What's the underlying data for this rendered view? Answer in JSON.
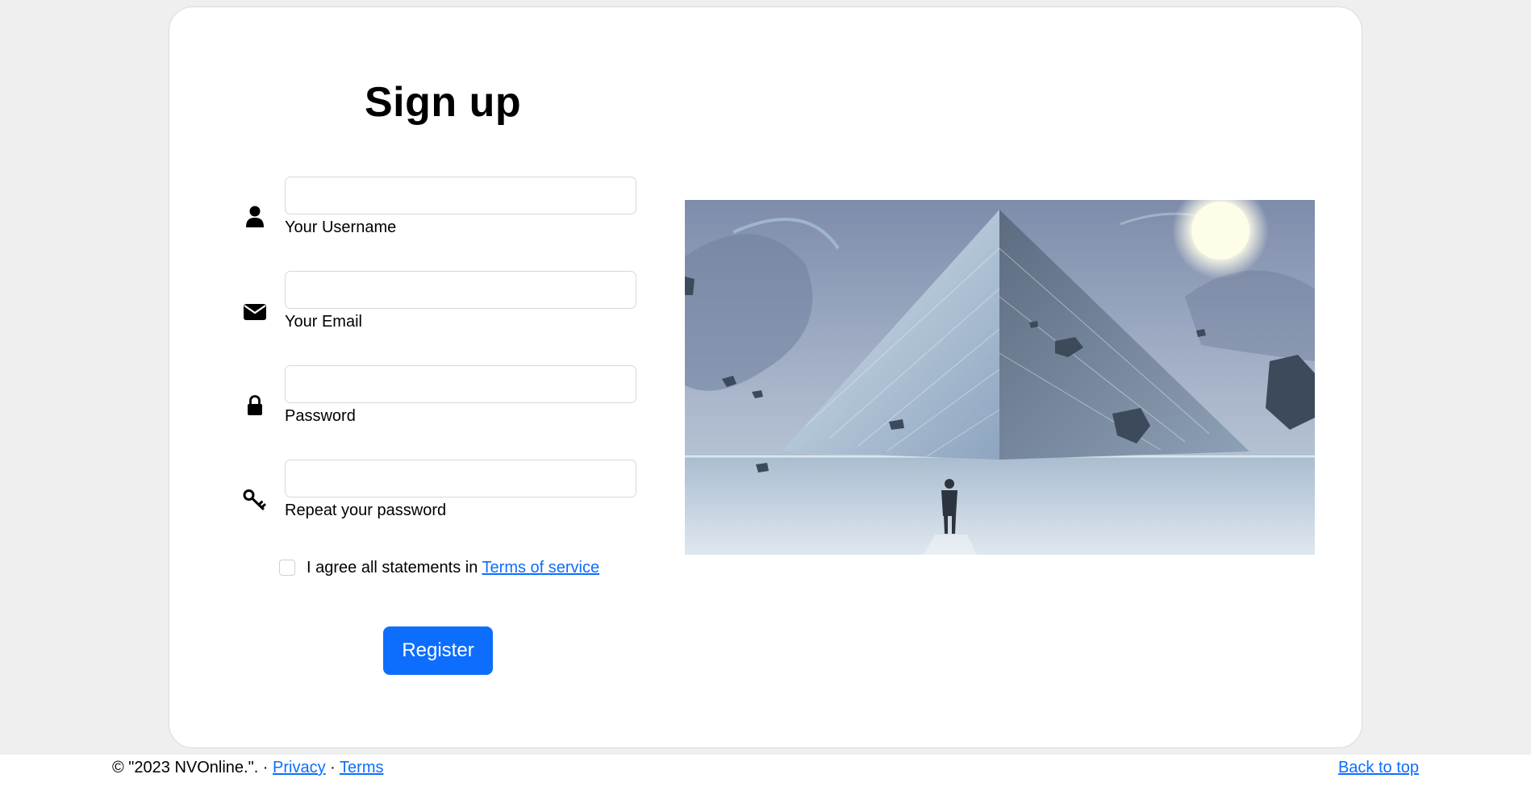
{
  "signup": {
    "title": "Sign up",
    "fields": [
      {
        "label": "Your Username",
        "value": "",
        "icon": "user-icon"
      },
      {
        "label": "Your Email",
        "value": "",
        "icon": "envelope-icon"
      },
      {
        "label": "Password",
        "value": "",
        "icon": "lock-icon"
      },
      {
        "label": "Repeat your password",
        "value": "",
        "icon": "key-icon"
      }
    ],
    "agree": {
      "text": "I agree all statements in ",
      "link": "Terms of service",
      "checked": false
    },
    "register_label": "Register"
  },
  "hero": {
    "image_name": "pyramid-sci-fi-illustration"
  },
  "footer": {
    "copyright": "© \"2023 NVOnline.\".",
    "separator": " · ",
    "privacy": "Privacy",
    "terms": "Terms",
    "back_to_top": "Back to top"
  },
  "colors": {
    "accent": "#0d6efd",
    "page_bg": "#efefef",
    "card_bg": "#ffffff"
  }
}
